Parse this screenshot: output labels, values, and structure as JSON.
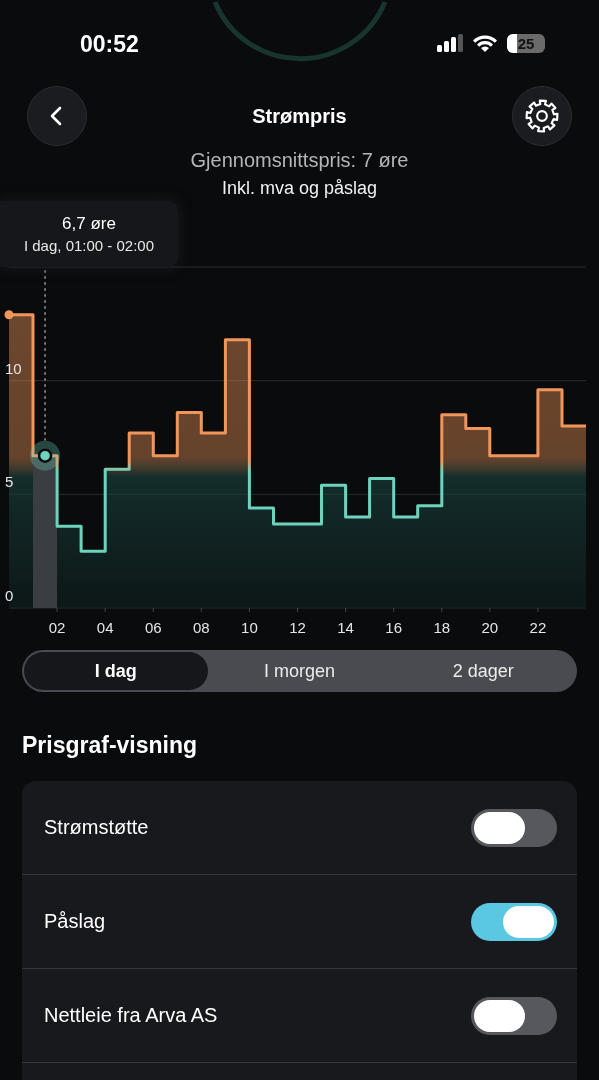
{
  "status_bar": {
    "time": "00:52",
    "battery": "25"
  },
  "header": {
    "title": "Strømpris"
  },
  "summary": {
    "average": "Gjennomsnittspris: 7 øre",
    "note": "Inkl. mva og påslag"
  },
  "chart": {
    "tooltip": {
      "value": "6,7 øre",
      "period": "I dag, 01:00 - 02:00"
    },
    "chart_data": {
      "type": "area",
      "x": [
        0,
        1,
        1,
        2,
        2,
        3,
        3,
        4,
        4,
        5,
        5,
        6,
        6,
        7,
        7,
        8,
        8,
        9,
        9,
        10,
        10,
        11,
        11,
        12,
        12,
        13,
        13,
        14,
        14,
        15,
        15,
        16,
        16,
        17,
        17,
        18,
        18,
        19,
        19,
        20,
        20,
        21,
        21,
        22,
        22,
        23,
        23,
        24
      ],
      "series": [
        {
          "color": "#f0965a",
          "values": [
            12.9,
            12.9,
            6.7,
            6.7,
            3.6,
            3.6,
            2.5,
            2.5,
            6.1,
            6.1,
            7.7,
            7.7,
            6.7,
            6.7,
            8.6,
            8.6,
            7.7,
            7.7,
            11.8,
            11.8,
            4.4,
            4.4,
            3.7,
            3.7,
            3.7,
            3.7,
            5.4,
            5.4,
            4.0,
            4.0,
            5.7,
            5.7,
            4.0,
            4.0,
            4.5,
            4.5,
            8.5,
            8.5,
            7.9,
            7.9,
            6.7,
            6.7,
            6.7,
            6.7,
            9.6,
            9.6,
            8.0,
            8.0
          ]
        },
        {
          "color": "#3a3d42",
          "values": [
            null,
            null,
            6.7,
            6.7,
            null,
            null,
            null,
            null,
            null,
            null,
            null,
            null,
            null,
            null,
            null,
            null,
            null,
            null,
            null,
            null,
            null,
            null,
            null,
            null,
            null,
            null,
            null,
            null,
            null,
            null,
            null,
            null,
            null,
            null,
            null,
            null,
            null,
            null,
            null,
            null,
            null,
            null,
            null,
            null,
            null,
            null,
            null,
            null
          ]
        }
      ],
      "xlim": [
        0,
        24
      ],
      "ylim": [
        0,
        15
      ],
      "yticks": [
        0,
        5,
        10
      ],
      "xticks": [
        {
          "value": 2,
          "label": "02"
        },
        {
          "value": 4,
          "label": "04"
        },
        {
          "value": 6,
          "label": "06"
        },
        {
          "value": 8,
          "label": "08"
        },
        {
          "value": 10,
          "label": "10"
        },
        {
          "value": 12,
          "label": "12"
        },
        {
          "value": 14,
          "label": "14"
        },
        {
          "value": 16,
          "label": "16"
        },
        {
          "value": 18,
          "label": "18"
        },
        {
          "value": 20,
          "label": "20"
        },
        {
          "value": 22,
          "label": "22"
        }
      ]
    }
  },
  "tabs": [
    {
      "label": "I dag",
      "selected": true
    },
    {
      "label": "I morgen",
      "selected": false
    },
    {
      "label": "2 dager",
      "selected": false
    }
  ],
  "section": {
    "title": "Prisgraf-visning",
    "rows": [
      {
        "label": "Strømstøtte",
        "on": false
      },
      {
        "label": "Påslag",
        "on": true
      },
      {
        "label": "Nettleie fra Arva AS",
        "on": false
      }
    ]
  }
}
